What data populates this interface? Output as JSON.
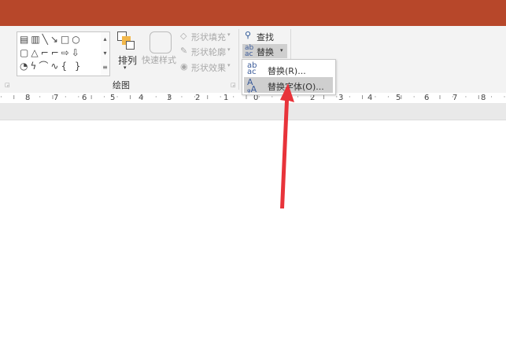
{
  "ribbon": {
    "drawing_group_label": "绘图",
    "arrange_label": "排列",
    "quick_styles_label": "快速样式",
    "shape_fill": "形状填充",
    "shape_outline": "形状轮廓",
    "shape_effects": "形状效果",
    "find_label": "查找",
    "replace_label": "替换"
  },
  "replace_menu": {
    "items": [
      {
        "label": "替换(R)...",
        "icon": "replace-abc-icon"
      },
      {
        "label": "替换字体(O)...",
        "icon": "replace-font-icon",
        "highlighted": true
      }
    ]
  },
  "ruler": {
    "labels": [
      "8",
      "7",
      "6",
      "5",
      "4",
      "3",
      "2",
      "1",
      "0",
      "1",
      "2",
      "3",
      "4",
      "5",
      "6",
      "7",
      "8"
    ]
  },
  "colors": {
    "title_bar": "#b7472a",
    "annotation_arrow": "#e8333a"
  }
}
